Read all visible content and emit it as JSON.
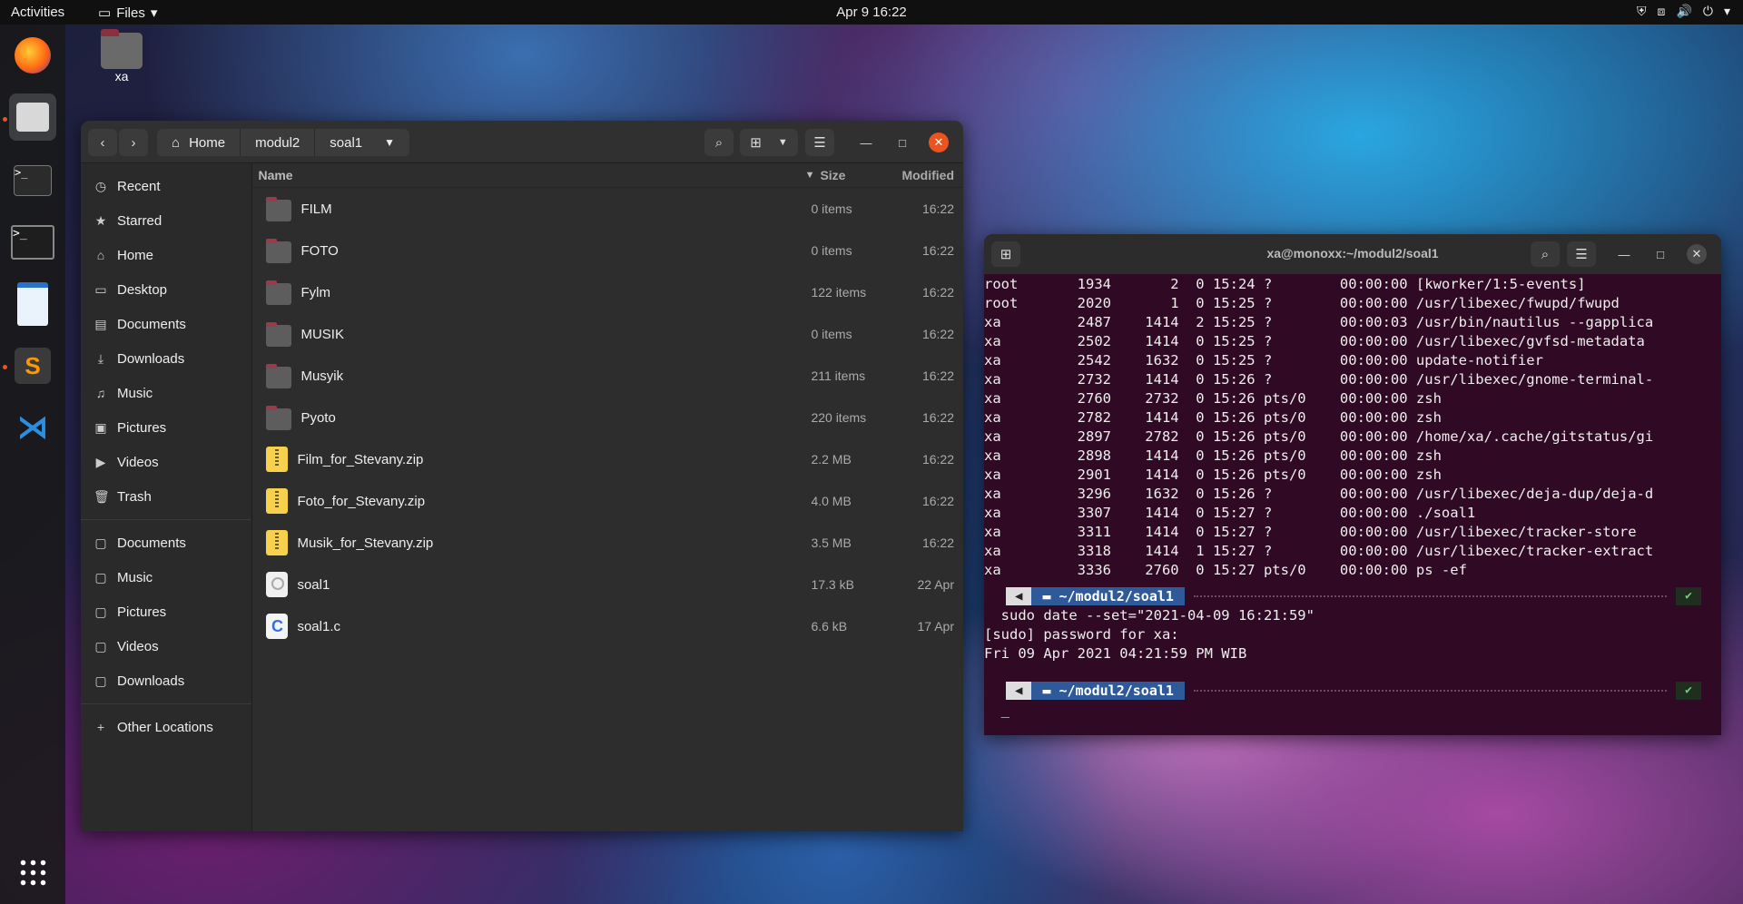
{
  "topbar": {
    "activities": "Activities",
    "app_menu": "Files",
    "clock": "Apr 9  16:22"
  },
  "desktop": {
    "home_icon_label": "xa"
  },
  "files": {
    "path": [
      "Home",
      "modul2",
      "soal1"
    ],
    "sidebar": {
      "places": [
        "Recent",
        "Starred",
        "Home",
        "Desktop",
        "Documents",
        "Downloads",
        "Music",
        "Pictures",
        "Videos",
        "Trash"
      ],
      "bookmarks": [
        "Documents",
        "Music",
        "Pictures",
        "Videos",
        "Downloads"
      ],
      "other": "Other Locations"
    },
    "columns": {
      "name": "Name",
      "size": "Size",
      "modified": "Modified"
    },
    "rows": [
      {
        "name": "FILM",
        "size": "0 items",
        "modified": "16:22",
        "type": "folder"
      },
      {
        "name": "FOTO",
        "size": "0 items",
        "modified": "16:22",
        "type": "folder"
      },
      {
        "name": "Fylm",
        "size": "122 items",
        "modified": "16:22",
        "type": "folder"
      },
      {
        "name": "MUSIK",
        "size": "0 items",
        "modified": "16:22",
        "type": "folder"
      },
      {
        "name": "Musyik",
        "size": "211 items",
        "modified": "16:22",
        "type": "folder"
      },
      {
        "name": "Pyoto",
        "size": "220 items",
        "modified": "16:22",
        "type": "folder"
      },
      {
        "name": "Film_for_Stevany.zip",
        "size": "2.2 MB",
        "modified": "16:22",
        "type": "zip"
      },
      {
        "name": "Foto_for_Stevany.zip",
        "size": "4.0 MB",
        "modified": "16:22",
        "type": "zip"
      },
      {
        "name": "Musik_for_Stevany.zip",
        "size": "3.5 MB",
        "modified": "16:22",
        "type": "zip"
      },
      {
        "name": "soal1",
        "size": "17.3 kB",
        "modified": "22 Apr",
        "type": "exec"
      },
      {
        "name": "soal1.c",
        "size": "6.6 kB",
        "modified": "17 Apr",
        "type": "csrc"
      }
    ]
  },
  "terminal": {
    "title": "xa@monoxx:~/modul2/soal1",
    "ps_lines": [
      "root       1934       2  0 15:24 ?        00:00:00 [kworker/1:5-events]",
      "root       2020       1  0 15:25 ?        00:00:00 /usr/libexec/fwupd/fwupd",
      "xa         2487    1414  2 15:25 ?        00:00:03 /usr/bin/nautilus --gapplica",
      "xa         2502    1414  0 15:25 ?        00:00:00 /usr/libexec/gvfsd-metadata",
      "xa         2542    1632  0 15:25 ?        00:00:00 update-notifier",
      "xa         2732    1414  0 15:26 ?        00:00:00 /usr/libexec/gnome-terminal-",
      "xa         2760    2732  0 15:26 pts/0    00:00:00 zsh",
      "xa         2782    1414  0 15:26 pts/0    00:00:00 zsh",
      "xa         2897    2782  0 15:26 pts/0    00:00:00 /home/xa/.cache/gitstatus/gi",
      "xa         2898    1414  0 15:26 pts/0    00:00:00 zsh",
      "xa         2901    1414  0 15:26 pts/0    00:00:00 zsh",
      "xa         3296    1632  0 15:26 ?        00:00:00 /usr/libexec/deja-dup/deja-d",
      "xa         3307    1414  0 15:27 ?        00:00:00 ./soal1",
      "xa         3311    1414  0 15:27 ?        00:00:00 /usr/libexec/tracker-store",
      "xa         3318    1414  1 15:27 ?        00:00:00 /usr/libexec/tracker-extract",
      "xa         3336    2760  0 15:27 pts/0    00:00:00 ps -ef"
    ],
    "prompt_dir": "~/modul2/soal1",
    "command": "  sudo date --set=\"2021-04-09 16:21:59\"",
    "output": [
      "[sudo] password for xa:",
      "Fri 09 Apr 2021 04:21:59 PM WIB"
    ],
    "cursor": "  _"
  }
}
